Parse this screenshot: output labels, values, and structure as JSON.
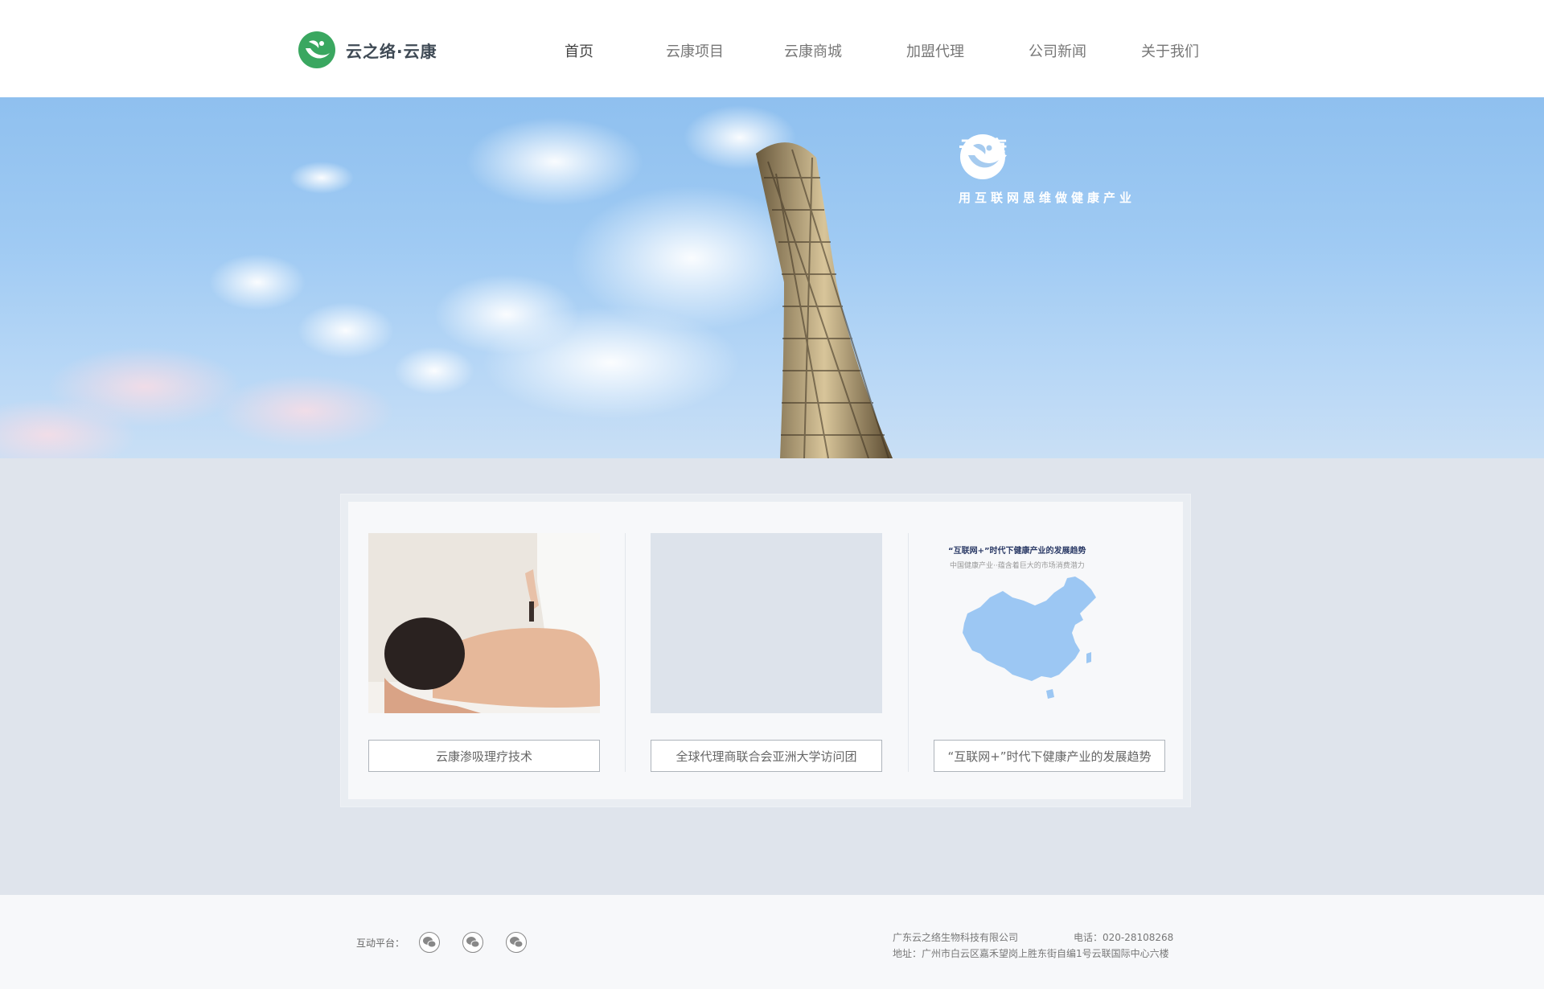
{
  "header": {
    "logo_text": "云之络·云康",
    "nav": [
      {
        "label": "首页",
        "active": true
      },
      {
        "label": "云康项目",
        "active": false
      },
      {
        "label": "云康商城",
        "active": false
      },
      {
        "label": "加盟代理",
        "active": false
      },
      {
        "label": "公司新闻",
        "active": false
      },
      {
        "label": "关于我们",
        "active": false
      }
    ]
  },
  "banner": {
    "brand": "云康",
    "slogan": "用互联网思维做健康产业"
  },
  "cards": [
    {
      "button_label": "云康渗吸理疗技术",
      "image": "massage-photo"
    },
    {
      "button_label": "全球代理商联合会亚洲大学访问团",
      "image": "placeholder"
    },
    {
      "button_label": "“互联网+”时代下健康产业的发展趋势",
      "image": "china-map",
      "image_title": "“互联网+”时代下健康产业的发展趋势",
      "image_subtitle": "中国健康产业··蕴含着巨大的市场消费潜力"
    }
  ],
  "footer": {
    "platform_label": "互动平台：",
    "social_icons": [
      "wechat-icon",
      "wechat-icon",
      "wechat-icon"
    ],
    "company": "广东云之络生物科技有限公司",
    "phone": "电话：020-28108268",
    "address": "地址：广州市白云区嘉禾望岗上胜东街自编1号云联国际中心六楼"
  },
  "colors": {
    "brand_green": "#3aa760",
    "sky": "#9fcaf3",
    "content_bg": "#dfe4ec"
  }
}
